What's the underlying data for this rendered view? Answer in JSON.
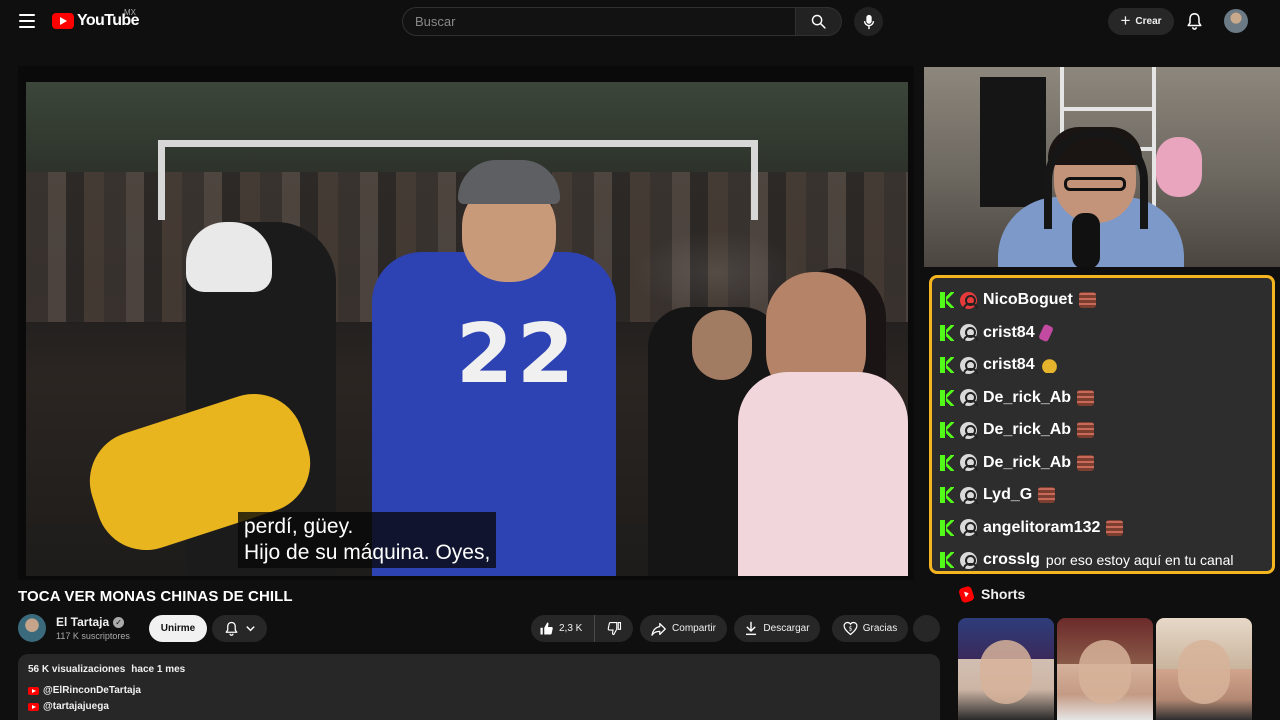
{
  "header": {
    "logo_text": "YouTube",
    "country_code": "MX",
    "search_placeholder": "Buscar",
    "create_label": "Crear"
  },
  "player": {
    "subtitle_line1": "perdí, güey.",
    "subtitle_line2": "Hijo de su máquina. Oyes,",
    "jersey_number": "22"
  },
  "chat": {
    "messages": [
      {
        "user": "NicoBoguet",
        "text": ""
      },
      {
        "user": "crist84",
        "text": ""
      },
      {
        "user": "crist84",
        "text": ""
      },
      {
        "user": "De_rick_Ab",
        "text": ""
      },
      {
        "user": "De_rick_Ab",
        "text": ""
      },
      {
        "user": "De_rick_Ab",
        "text": ""
      },
      {
        "user": "Lyd_G",
        "text": ""
      },
      {
        "user": "angelitoram132",
        "text": ""
      },
      {
        "user": "crosslg",
        "text": "por eso estoy aquí en tu canal"
      }
    ],
    "border_color": "#f4b51f",
    "badge_color": "#53fc18"
  },
  "video": {
    "title": "TOCA VER MONAS CHINAS DE CHILL",
    "channel_name": "El Tartaja",
    "subscribers": "117 K suscriptores",
    "join_label": "Unirme",
    "likes": "2,3 K",
    "share_label": "Compartir",
    "download_label": "Descargar",
    "thanks_label": "Gracias"
  },
  "description": {
    "views": "56 K visualizaciones",
    "date": "hace 1 mes",
    "links": [
      "@ElRinconDeTartaja",
      "@tartajajuega"
    ]
  },
  "shorts": {
    "heading": "Shorts"
  },
  "colors": {
    "background": "#0f0f0f",
    "brand_red": "#ff0000",
    "pill_bg": "#272727"
  }
}
